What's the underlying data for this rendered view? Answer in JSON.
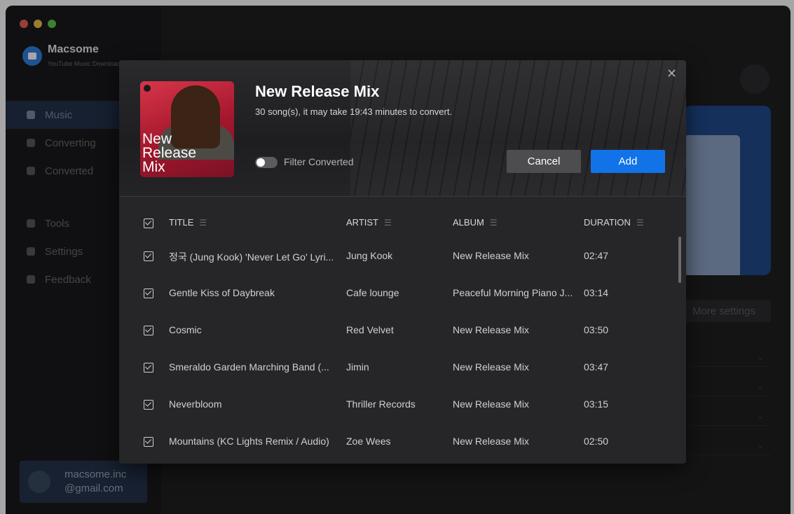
{
  "app": {
    "name": "Macsome",
    "subtitle": "YouTube Music Downloader"
  },
  "sidebar": {
    "items": [
      {
        "label": "Music",
        "icon": "headphones-icon",
        "active": true
      },
      {
        "label": "Converting",
        "icon": "converting-icon",
        "active": false
      },
      {
        "label": "Converted",
        "icon": "clock-icon",
        "active": false
      },
      {
        "label": "Tools",
        "icon": "toolbox-icon",
        "active": false
      },
      {
        "label": "Settings",
        "icon": "gear-icon",
        "active": false
      },
      {
        "label": "Feedback",
        "icon": "mail-icon",
        "active": false
      }
    ],
    "user": {
      "line1": "macsome.inc",
      "line2": "@gmail.com"
    }
  },
  "background": {
    "more_settings": "More settings"
  },
  "dialog": {
    "cover": {
      "line1": "New",
      "line2": "Release",
      "line3": "Mix"
    },
    "title": "New Release Mix",
    "subtitle": "30 song(s), it may take 19:43 minutes to convert.",
    "filter_label": "Filter Converted",
    "filter_on": false,
    "cancel_label": "Cancel",
    "add_label": "Add",
    "close_icon": "close-icon",
    "colors": {
      "accent": "#1273e8",
      "cancel": "#4d4d50"
    }
  },
  "table": {
    "headers": {
      "title": "TITLE",
      "artist": "ARTIST",
      "album": "ALBUM",
      "duration": "DURATION"
    },
    "rows": [
      {
        "title": "정국 (Jung Kook) 'Never Let Go' Lyri...",
        "artist": "Jung Kook",
        "album": "New Release Mix",
        "duration": "02:47",
        "checked": true
      },
      {
        "title": "Gentle Kiss of Daybreak",
        "artist": "Cafe lounge",
        "album": "Peaceful Morning Piano J...",
        "duration": "03:14",
        "checked": true
      },
      {
        "title": "Cosmic",
        "artist": "Red Velvet",
        "album": "New Release Mix",
        "duration": "03:50",
        "checked": true
      },
      {
        "title": "Smeraldo Garden Marching Band (...",
        "artist": "Jimin",
        "album": "New Release Mix",
        "duration": "03:47",
        "checked": true
      },
      {
        "title": "Neverbloom",
        "artist": "Thriller Records",
        "album": "New Release Mix",
        "duration": "03:15",
        "checked": true
      },
      {
        "title": "Mountains (KC Lights Remix / Audio)",
        "artist": "Zoe Wees",
        "album": "New Release Mix",
        "duration": "02:50",
        "checked": true
      }
    ]
  }
}
